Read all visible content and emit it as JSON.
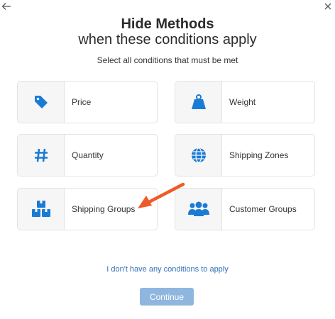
{
  "header": {
    "title": "Hide Methods",
    "subtitle": "when these conditions apply",
    "instruction": "Select all conditions that must be met"
  },
  "conditions": [
    {
      "label": "Price",
      "icon": "price-tag-icon"
    },
    {
      "label": "Weight",
      "icon": "weight-icon"
    },
    {
      "label": "Quantity",
      "icon": "hash-icon"
    },
    {
      "label": "Shipping Zones",
      "icon": "globe-icon"
    },
    {
      "label": "Shipping Groups",
      "icon": "boxes-icon"
    },
    {
      "label": "Customer Groups",
      "icon": "users-icon"
    }
  ],
  "footer": {
    "no_conditions_link": "I don't have any conditions to apply",
    "continue_label": "Continue"
  },
  "colors": {
    "accent": "#1a7bd4",
    "link": "#2f6fba",
    "continue_disabled": "#8fb6df",
    "annotation_arrow": "#ef5a28"
  }
}
